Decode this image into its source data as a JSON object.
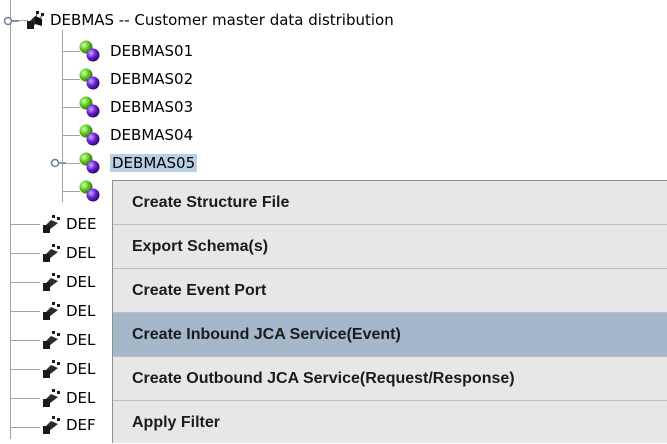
{
  "tree": {
    "parent": {
      "label": "DEBMAS -- Customer master data distribution",
      "icon": "package-nodes-icon"
    },
    "children": [
      {
        "label": "DEBMAS01",
        "icon": "molecule-icon"
      },
      {
        "label": "DEBMAS02",
        "icon": "molecule-icon"
      },
      {
        "label": "DEBMAS03",
        "icon": "molecule-icon"
      },
      {
        "label": "DEBMAS04",
        "icon": "molecule-icon"
      },
      {
        "label": "DEBMAS05",
        "icon": "molecule-icon",
        "selected": true
      }
    ],
    "partial_siblings": [
      "DEE",
      "DEL",
      "DEL",
      "DEL",
      "DEL",
      "DEL",
      "DEL",
      "DEF"
    ]
  },
  "context_menu": {
    "items": [
      {
        "label": "Create Structure File"
      },
      {
        "label": "Export Schema(s)"
      },
      {
        "label": "Create Event Port"
      },
      {
        "label": "Create Inbound JCA Service(Event)",
        "highlighted": true
      },
      {
        "label": "Create Outbound JCA Service(Request/Response)"
      },
      {
        "label": "Apply Filter"
      }
    ]
  },
  "colors": {
    "selection": "#b8cfe5",
    "menu_background": "#e7e7e7",
    "menu_highlight": "#a4b7cb",
    "tree_lines": "#9aa6b2"
  }
}
